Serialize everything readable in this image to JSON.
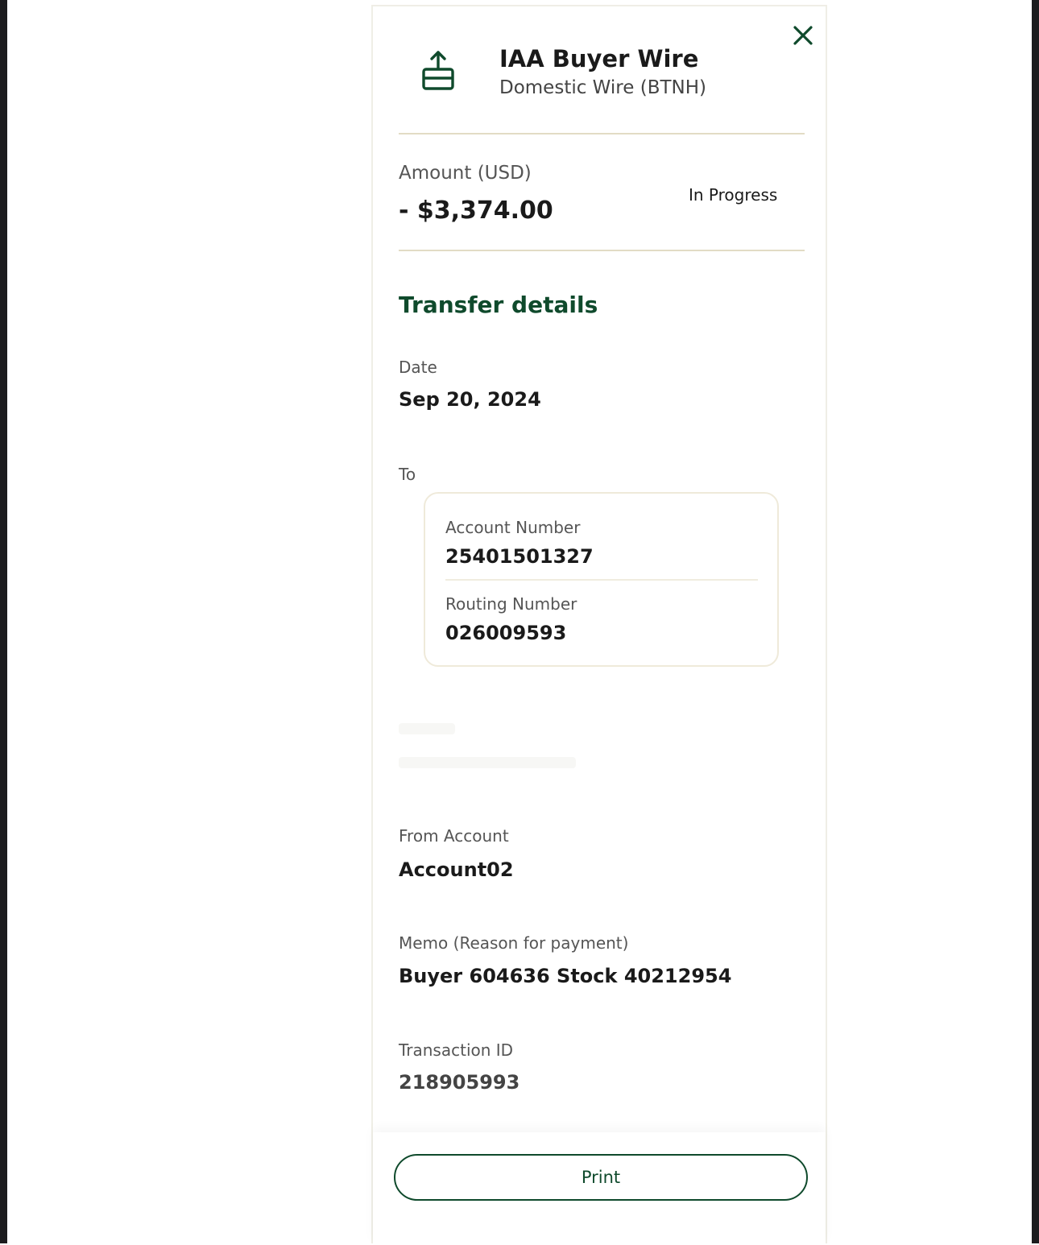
{
  "header": {
    "title": "IAA Buyer Wire",
    "subtitle": "Domestic Wire (BTNH)",
    "icon": "transfer-upload-icon",
    "close_icon": "close-icon"
  },
  "amount": {
    "label": "Amount (USD)",
    "value": "- $3,374.00",
    "status": "In Progress"
  },
  "details": {
    "section_title": "Transfer details",
    "date_label": "Date",
    "date_value": "Sep 20, 2024",
    "to_label": "To",
    "to_card": {
      "account_number_label": "Account Number",
      "account_number_value": "25401501327",
      "routing_number_label": "Routing Number",
      "routing_number_value": "026009593"
    },
    "from_account_label": "From Account",
    "from_account_value": "Account02",
    "memo_label": "Memo (Reason for payment)",
    "memo_value": "Buyer 604636 Stock 40212954",
    "transaction_id_label": "Transaction ID",
    "transaction_id_value": "218905993"
  },
  "footer": {
    "print_label": "Print"
  },
  "colors": {
    "accent_green": "#0f4a2c",
    "divider": "#e2dcc5",
    "frame_dark": "#1c1c1e"
  }
}
